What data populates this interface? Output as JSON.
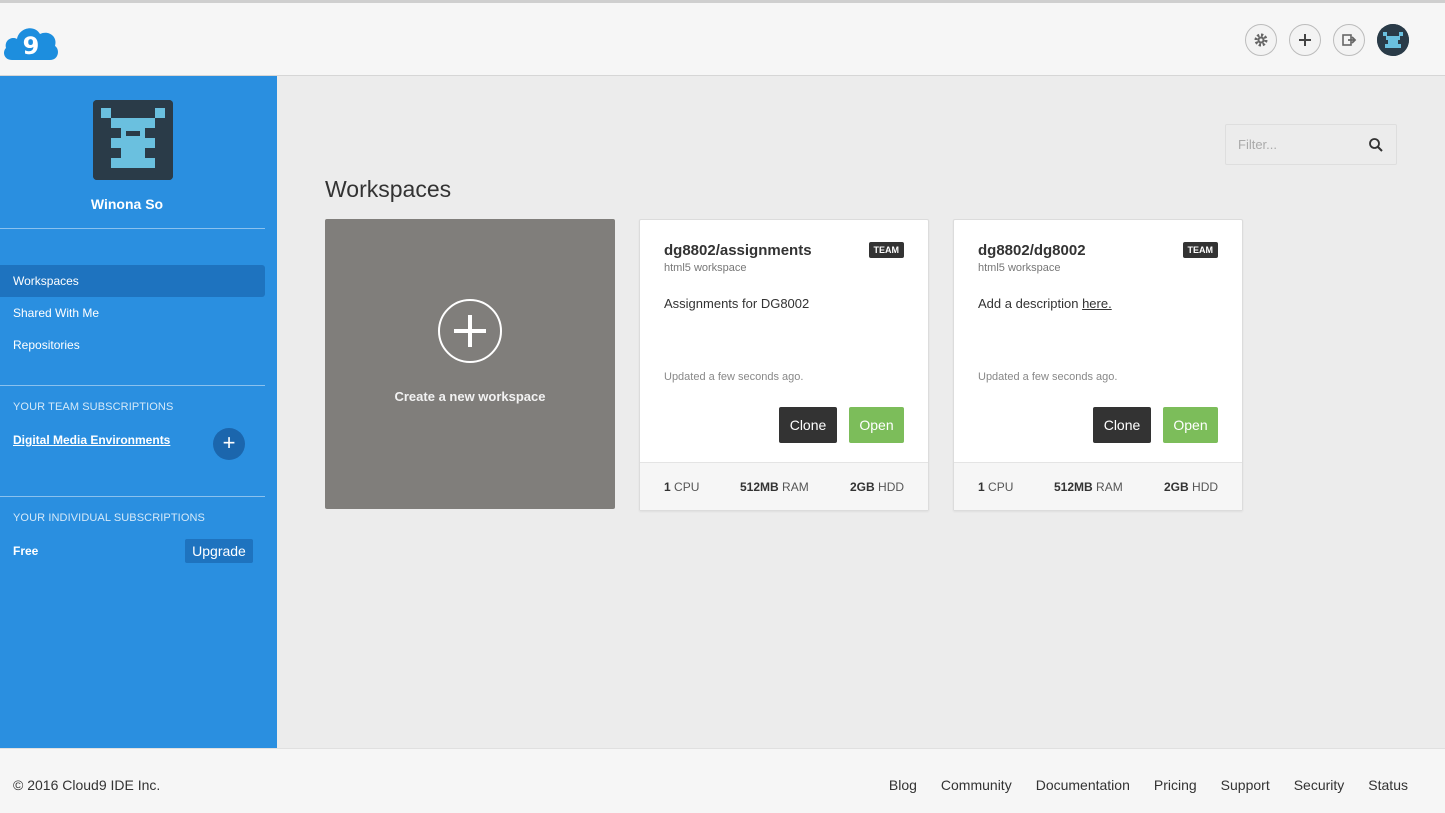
{
  "header": {
    "logo_icon": "cloud9-logo",
    "settings_icon": "gear-icon",
    "add_icon": "plus-icon",
    "logout_icon": "sign-out-icon",
    "avatar_icon": "user-avatar"
  },
  "sidebar": {
    "user_name": "Winona So",
    "nav": [
      "Workspaces",
      "Shared With Me",
      "Repositories"
    ],
    "active_nav": "Workspaces",
    "team_section_title": "YOUR TEAM SUBSCRIPTIONS",
    "team_name": "Digital Media Environments",
    "team_add_label": "+",
    "individual_section_title": "YOUR INDIVIDUAL SUBSCRIPTIONS",
    "plan": "Free",
    "upgrade_label": "Upgrade"
  },
  "filter": {
    "placeholder": "Filter..."
  },
  "main": {
    "title": "Workspaces",
    "create_label": "Create a new workspace",
    "workspaces": [
      {
        "name": "dg8802/assignments",
        "badge": "TEAM",
        "type": "html5 workspace",
        "description": "Assignments for DG8002",
        "description_link": "",
        "updated": "Updated a few seconds ago.",
        "clone_label": "Clone",
        "open_label": "Open",
        "cpu_value": "1",
        "cpu_unit": "CPU",
        "ram_value": "512MB",
        "ram_unit": "RAM",
        "hdd_value": "2GB",
        "hdd_unit": "HDD"
      },
      {
        "name": "dg8802/dg8002",
        "badge": "TEAM",
        "type": "html5 workspace",
        "description": "Add a description ",
        "description_link": "here.",
        "updated": "Updated a few seconds ago.",
        "clone_label": "Clone",
        "open_label": "Open",
        "cpu_value": "1",
        "cpu_unit": "CPU",
        "ram_value": "512MB",
        "ram_unit": "RAM",
        "hdd_value": "2GB",
        "hdd_unit": "HDD"
      }
    ]
  },
  "footer": {
    "copyright": "© 2016 Cloud9 IDE Inc.",
    "links": [
      "Blog",
      "Community",
      "Documentation",
      "Pricing",
      "Support",
      "Security",
      "Status"
    ]
  },
  "colors": {
    "sidebar": "#2a8fe0",
    "sidebar_active": "#1e73bf",
    "open_button": "#7cbd5a",
    "clone_button": "#333333",
    "create_card": "#807e7b"
  }
}
